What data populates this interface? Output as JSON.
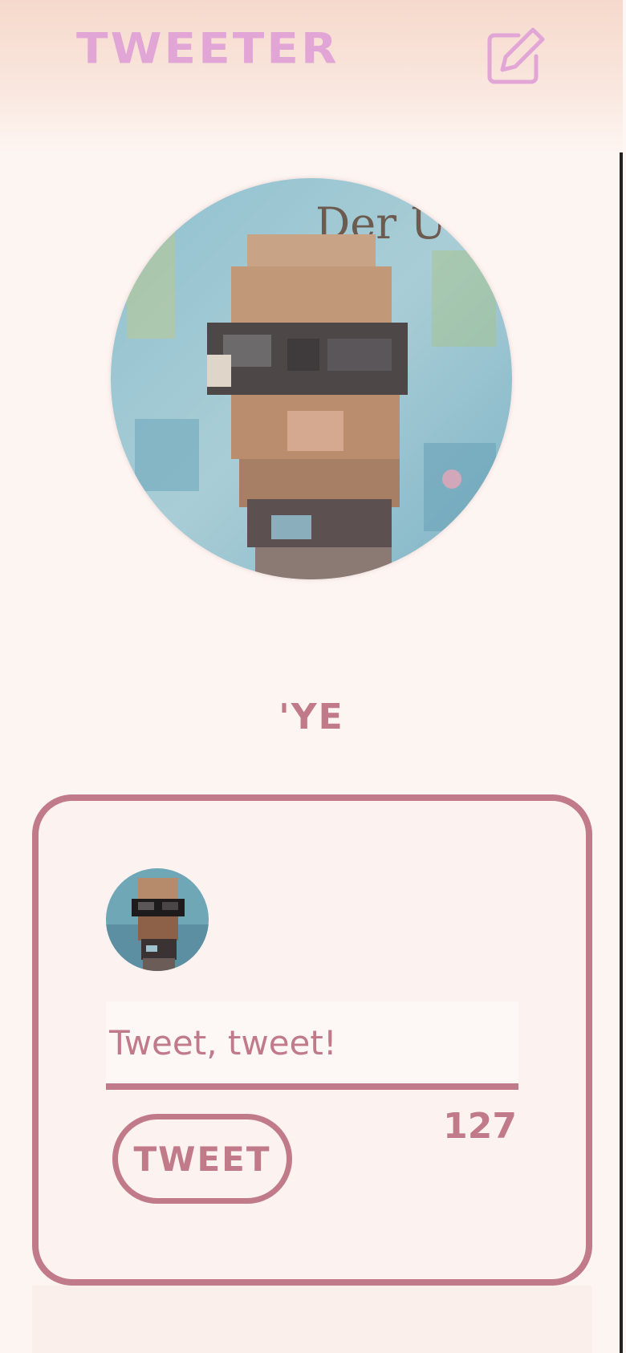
{
  "app": {
    "title": "TWEETER"
  },
  "header": {
    "compose_icon": "compose-icon"
  },
  "profile": {
    "username": "'YE",
    "avatar": "profile-avatar"
  },
  "composer": {
    "placeholder": "Tweet, tweet!",
    "value": "",
    "remaining_chars": "127",
    "submit_label": "TWEET"
  },
  "colors": {
    "brand": "#e1a6d6",
    "accent": "#c07a89",
    "background": "#fdf5f2",
    "header_top": "#f6d9cc"
  }
}
